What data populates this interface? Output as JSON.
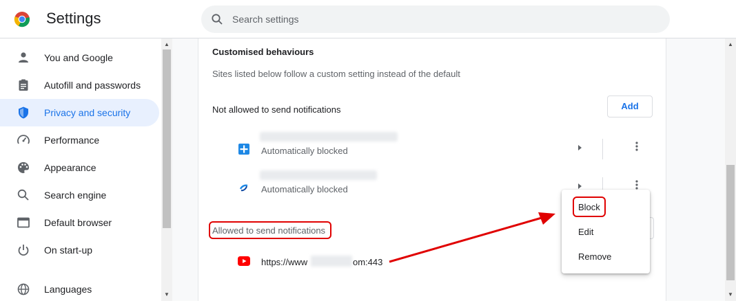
{
  "header": {
    "title": "Settings",
    "search_placeholder": "Search settings"
  },
  "sidebar": {
    "items": [
      {
        "label": "You and Google",
        "icon": "person-icon"
      },
      {
        "label": "Autofill and passwords",
        "icon": "clipboard-icon"
      },
      {
        "label": "Privacy and security",
        "icon": "shield-icon",
        "active": true
      },
      {
        "label": "Performance",
        "icon": "speedometer-icon"
      },
      {
        "label": "Appearance",
        "icon": "palette-icon"
      },
      {
        "label": "Search engine",
        "icon": "search-icon"
      },
      {
        "label": "Default browser",
        "icon": "browser-icon"
      },
      {
        "label": "On start-up",
        "icon": "power-icon"
      },
      {
        "label": "Languages",
        "icon": "globe-icon"
      }
    ]
  },
  "main": {
    "section_heading": "Customised behaviours",
    "section_description": "Sites listed below follow a custom setting instead of the default",
    "not_allowed_heading": "Not allowed to send notifications",
    "add_label": "Add",
    "blocked_sites": [
      {
        "status": "Automatically blocked",
        "icon": "site-favicon-blue"
      },
      {
        "status": "Automatically blocked",
        "icon": "site-favicon-link"
      }
    ],
    "allowed_heading": "Allowed to send notifications",
    "allowed_site": {
      "url_prefix": "https://www",
      "url_suffix": "om:443",
      "icon": "youtube-icon"
    }
  },
  "context_menu": {
    "items": [
      "Block",
      "Edit",
      "Remove"
    ]
  },
  "colors": {
    "accent": "#1a73e8",
    "active_bg": "#e8f0fe",
    "annotation": "#e00000"
  }
}
